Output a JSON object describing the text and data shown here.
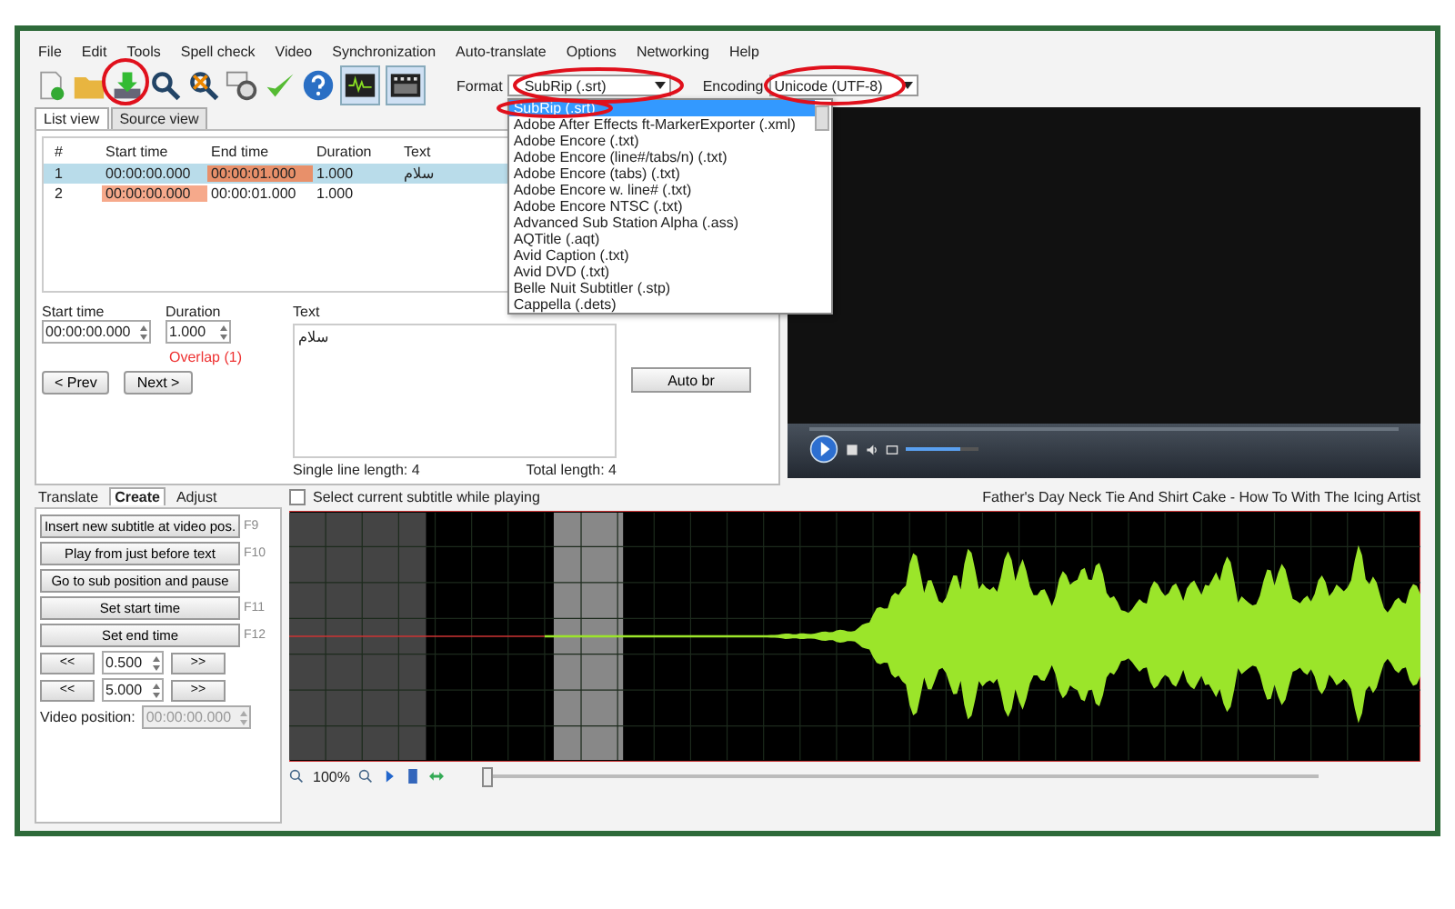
{
  "menu": [
    "File",
    "Edit",
    "Tools",
    "Spell check",
    "Video",
    "Synchronization",
    "Auto-translate",
    "Options",
    "Networking",
    "Help"
  ],
  "toolbar": {
    "format_label": "Format",
    "format_value": "SubRip (.srt)",
    "encoding_label": "Encoding",
    "encoding_value": "Unicode (UTF-8)"
  },
  "format_options": [
    {
      "label": "SubRip (.srt)",
      "selected": true
    },
    {
      "label": "Adobe After Effects ft-MarkerExporter (.xml)",
      "selected": false
    },
    {
      "label": "Adobe Encore (.txt)",
      "selected": false
    },
    {
      "label": "Adobe Encore (line#/tabs/n) (.txt)",
      "selected": false
    },
    {
      "label": "Adobe Encore (tabs) (.txt)",
      "selected": false
    },
    {
      "label": "Adobe Encore w. line# (.txt)",
      "selected": false
    },
    {
      "label": "Adobe Encore NTSC (.txt)",
      "selected": false
    },
    {
      "label": "Advanced Sub Station Alpha (.ass)",
      "selected": false
    },
    {
      "label": "AQTitle (.aqt)",
      "selected": false
    },
    {
      "label": "Avid Caption (.txt)",
      "selected": false
    },
    {
      "label": "Avid DVD (.txt)",
      "selected": false
    },
    {
      "label": "Belle Nuit Subtitler (.stp)",
      "selected": false
    },
    {
      "label": "Cappella (.dets)",
      "selected": false
    }
  ],
  "list_tabs": [
    {
      "label": "List view",
      "selected": true
    },
    {
      "label": "Source view",
      "selected": false
    }
  ],
  "columns": [
    "#",
    "Start time",
    "End time",
    "Duration",
    "Text"
  ],
  "rows": [
    {
      "selected": true,
      "cells": [
        {
          "text": "1",
          "flagged": false
        },
        {
          "text": "00:00:00.000",
          "flagged": false
        },
        {
          "text": "00:00:01.000",
          "flagged": true
        },
        {
          "text": "1.000",
          "flagged": false
        },
        {
          "text": "سلام",
          "flagged": false
        }
      ]
    },
    {
      "selected": false,
      "cells": [
        {
          "text": "2",
          "flagged": false
        },
        {
          "text": "00:00:00.000",
          "flagged": true
        },
        {
          "text": "00:00:01.000",
          "flagged": false
        },
        {
          "text": "1.000",
          "flagged": false
        }
      ]
    }
  ],
  "edit": {
    "start_label": "Start time",
    "start_value": "00:00:00.000",
    "duration_label": "Duration",
    "duration_value": "1.000",
    "text_label": "Text",
    "text_value": "سلام",
    "overlap": "Overlap (1)",
    "prev": "< Prev",
    "next": "Next >",
    "single_length": "Single line length: 4",
    "total_length": "Total length: 4",
    "auto_br": "Auto br"
  },
  "video": {
    "volume": {
      "level": 0.75
    }
  },
  "bottom_tabs": [
    {
      "label": "Translate",
      "selected": false
    },
    {
      "label": "Create",
      "selected": true
    },
    {
      "label": "Adjust",
      "selected": false
    }
  ],
  "create_buttons": [
    {
      "label": "Insert new subtitle at video pos.",
      "key": "F9"
    },
    {
      "label": "Play from just before text",
      "key": "F10"
    },
    {
      "label": "Go to sub position and pause"
    },
    {
      "label": "Set start time",
      "key": "F11"
    },
    {
      "label": "Set end time",
      "key": "F12"
    }
  ],
  "steps": [
    {
      "back": "<<",
      "value": "0.500",
      "forward": ">>"
    },
    {
      "back": "<<",
      "value": "5.000",
      "forward": ">>"
    }
  ],
  "video_position": {
    "label": "Video position:",
    "value": "00:00:00.000",
    "disabled": true
  },
  "waveform": {
    "checkbox_label": "Select current subtitle while playing",
    "checked": false,
    "video_title": "Father's Day Neck Tie And Shirt Cake - How To With The Icing Artist",
    "zoom": "100%",
    "position": {
      "level": 0.0
    }
  }
}
